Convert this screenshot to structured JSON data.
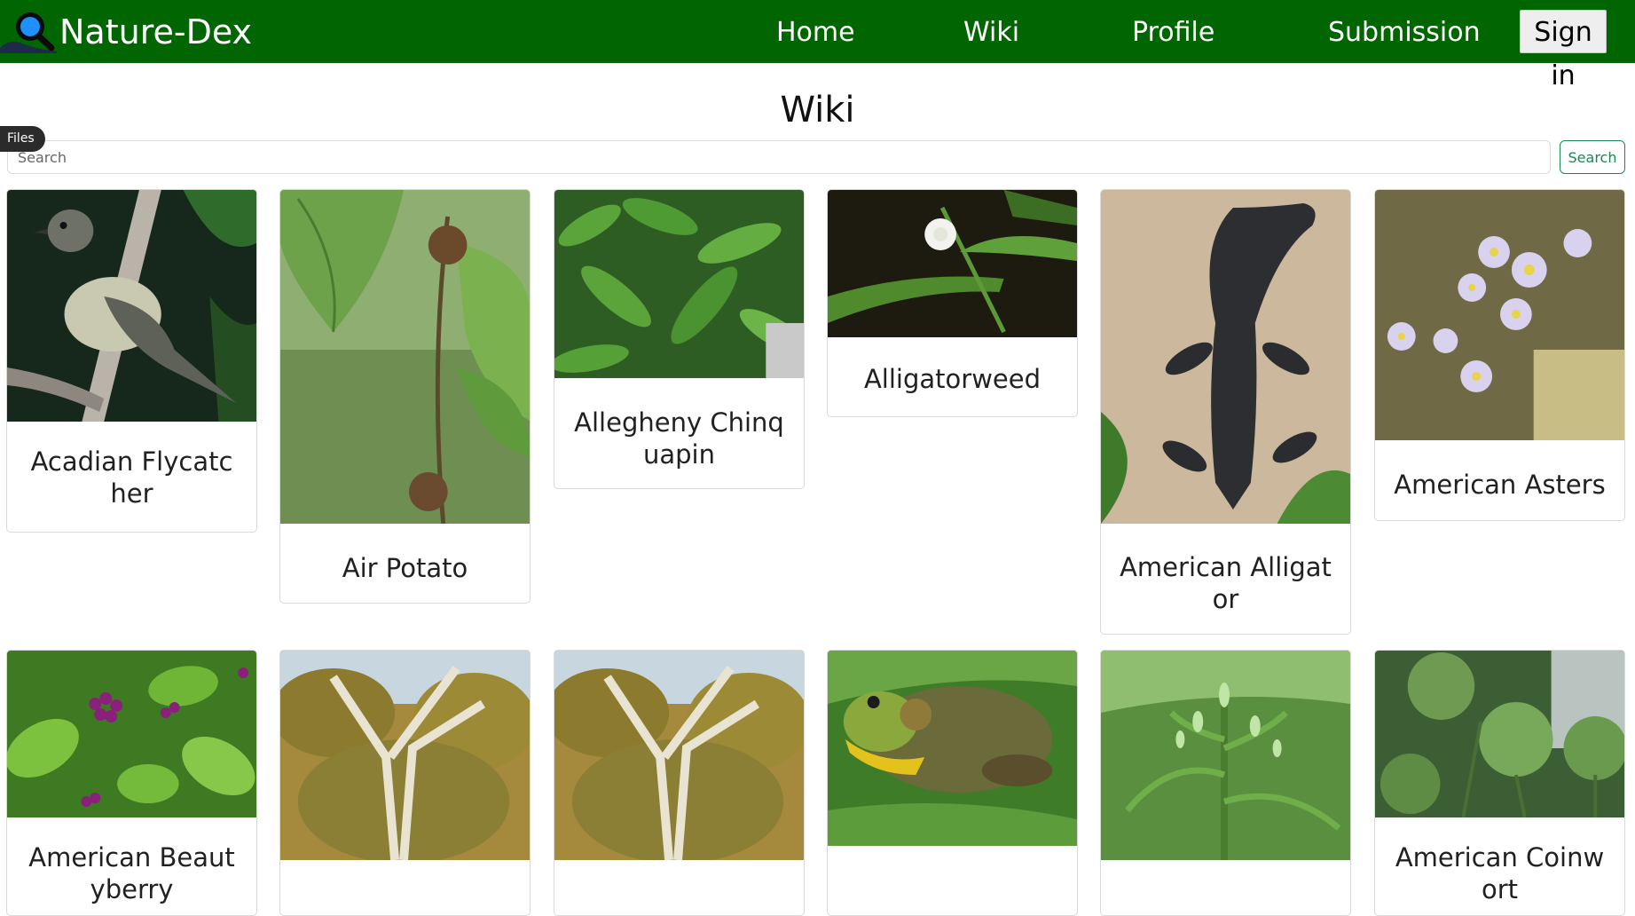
{
  "app": {
    "name": "Nature-Dex"
  },
  "nav": {
    "home": "Home",
    "wiki": "Wiki",
    "profile": "Profile",
    "submission": "Submission",
    "signin": "Sign in"
  },
  "page": {
    "title": "Wiki"
  },
  "files_pill": "Files",
  "search": {
    "placeholder": "Search",
    "button": "Search"
  },
  "colors": {
    "navbar": "#016602",
    "accent": "#198754"
  },
  "cards": [
    {
      "title": "Acadian Flycatcher",
      "image": "bird-photo"
    },
    {
      "title": "Air Potato",
      "image": "vine-photo"
    },
    {
      "title": "Allegheny Chinquapin",
      "image": "leaves-photo"
    },
    {
      "title": "Alligatorweed",
      "image": "flower-photo"
    },
    {
      "title": "American Alligator",
      "image": "alligator-photo"
    },
    {
      "title": "American Asters",
      "image": "aster-photo"
    },
    {
      "title": "American Beautyberry",
      "image": "berry-photo"
    },
    {
      "title": "",
      "image": "tree-photo"
    },
    {
      "title": "",
      "image": "tree-photo"
    },
    {
      "title": "",
      "image": "frog-photo"
    },
    {
      "title": "",
      "image": "plant-photo"
    },
    {
      "title": "American Coinwort",
      "image": "coinwort-photo"
    }
  ]
}
